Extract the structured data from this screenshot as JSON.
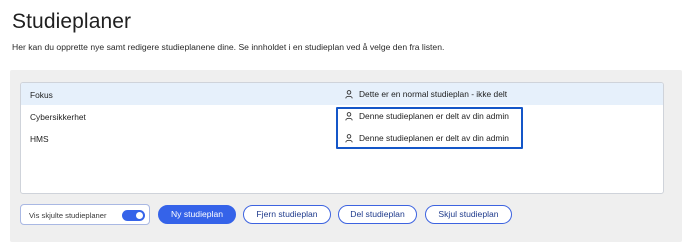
{
  "page": {
    "title": "Studieplaner",
    "description": "Her kan du opprette nye samt redigere studieplanene dine. Se innholdet i en studieplan ved å velge den fra listen."
  },
  "list": {
    "rows": [
      {
        "name": "Fokus",
        "status": "Dette er en normal studieplan - ikke delt",
        "selected": true
      },
      {
        "name": "Cybersikkerhet",
        "status": "Denne studieplanen er delt av din admin",
        "selected": false
      },
      {
        "name": "HMS",
        "status": "Denne studieplanen er delt av din admin",
        "selected": false
      }
    ]
  },
  "controls": {
    "toggle_label": "Vis skjulte studieplaner",
    "toggle_on": true,
    "new_label": "Ny studieplan",
    "remove_label": "Fjern studieplan",
    "share_label": "Del studieplan",
    "hide_label": "Skjul studieplan"
  },
  "colors": {
    "accent": "#3563e9",
    "highlight": "#1456c8",
    "selected_row": "#e6f0fb"
  }
}
